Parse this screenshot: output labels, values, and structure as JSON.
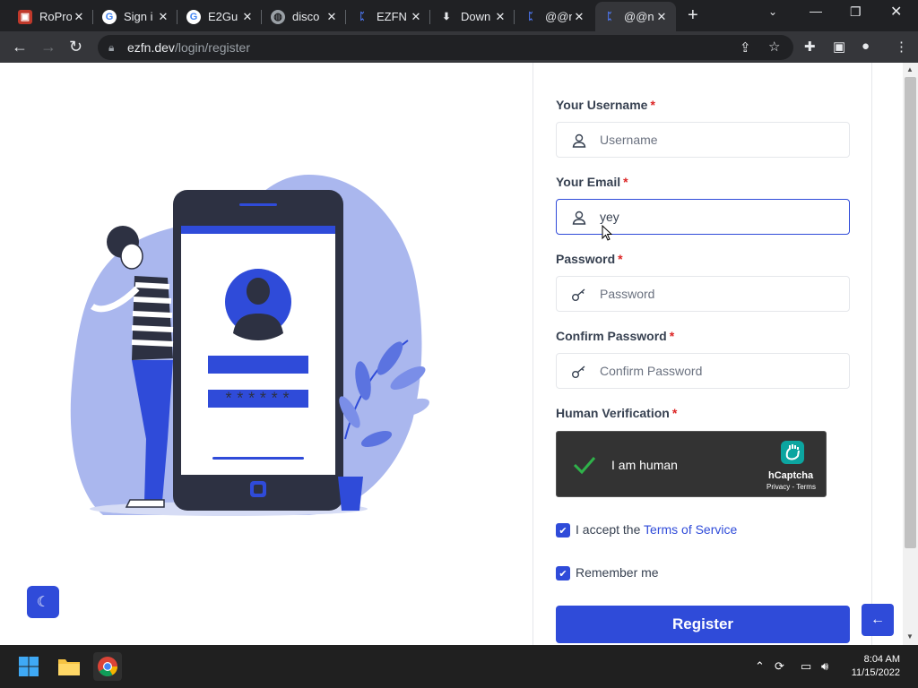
{
  "browser": {
    "tabs": [
      {
        "title": "RoPro",
        "favicon": "ropro-icon"
      },
      {
        "title": "Sign i",
        "favicon": "google-icon"
      },
      {
        "title": "E2Gu",
        "favicon": "google-icon"
      },
      {
        "title": "disco",
        "favicon": "globe-icon"
      },
      {
        "title": "EZFN",
        "favicon": "ezfn-icon"
      },
      {
        "title": "Down",
        "favicon": "download-icon"
      },
      {
        "title": "@@n",
        "favicon": "ezfn-icon"
      },
      {
        "title": "@@n",
        "favicon": "ezfn-icon"
      }
    ],
    "new_tab_label": "+",
    "url_domain": "ezfn.dev",
    "url_path": "/login/register"
  },
  "form": {
    "username_label": "Your Username",
    "username_placeholder": "Username",
    "username_value": "",
    "email_label": "Your Email",
    "email_value": "yey",
    "password_label": "Password",
    "password_placeholder": "Password",
    "confirm_label": "Confirm Password",
    "confirm_placeholder": "Confirm Password",
    "verification_label": "Human Verification",
    "required_mark": "*",
    "captcha_text": "I am human",
    "captcha_brand": "hCaptcha",
    "captcha_links": "Privacy - Terms",
    "tos_prefix": "I accept the",
    "tos_link": "Terms of Service",
    "tos_checked": true,
    "remember_label": "Remember me",
    "remember_checked": true,
    "register_label": "Register"
  },
  "illustration": {
    "password_mask": "******"
  },
  "taskbar": {
    "time": "8:04 AM",
    "date": "11/15/2022"
  },
  "colors": {
    "accent": "#2f4bd9",
    "required": "#dc2626",
    "illustration_blue": "#2f4bd9",
    "illustration_light": "#aab7ee",
    "phone_dark": "#2d3142"
  }
}
